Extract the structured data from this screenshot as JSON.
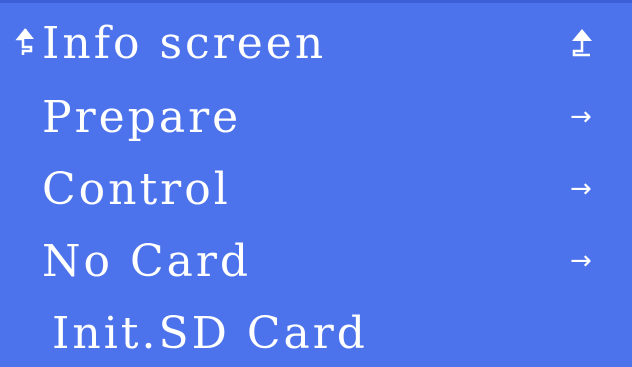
{
  "screen": {
    "background_color": "#4c72ec",
    "text_color": "#ffffff"
  },
  "menu": {
    "items": [
      {
        "label": "Info screen",
        "prefix_icon": "up-return-icon",
        "suffix_icon": "up-return-icon"
      },
      {
        "label": "Prepare",
        "suffix_glyph": "→",
        "suffix_icon": "arrow-right-icon"
      },
      {
        "label": "Control",
        "suffix_glyph": "→",
        "suffix_icon": "arrow-right-icon"
      },
      {
        "label": "No Card",
        "suffix_glyph": "→",
        "suffix_icon": "arrow-right-icon"
      },
      {
        "label": "Init.SD Card"
      }
    ]
  }
}
